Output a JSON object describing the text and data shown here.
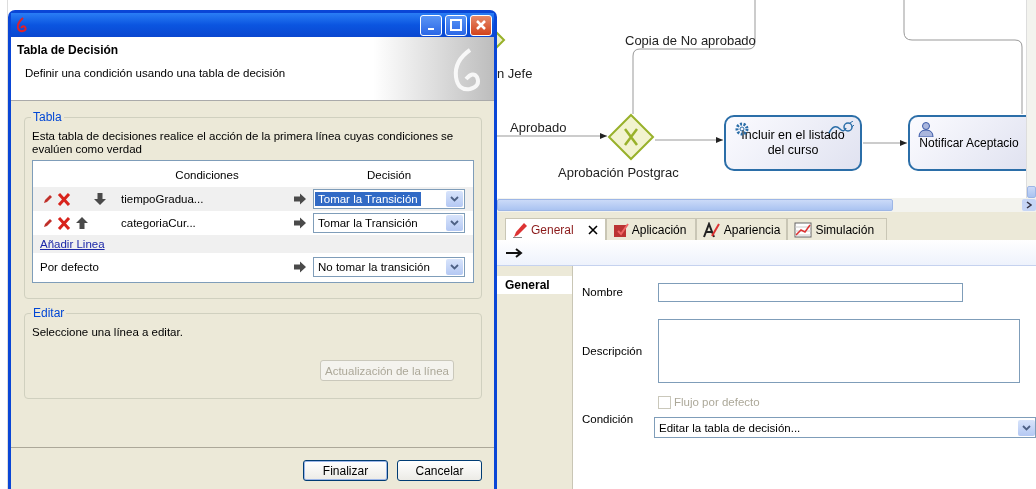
{
  "dialog": {
    "title": "Tabla de Decisión",
    "subtitle": "Definir una condición usando una tabla de decisión",
    "table_group": {
      "label": "Tabla",
      "description": "Esta tabla de decisiones realice el acción de la primera línea cuyas condiciones se evalúen como verdad",
      "columns": [
        "Condiciones",
        "Decisión"
      ],
      "rows": [
        {
          "condition": "tiempoGradua...",
          "decision": "Tomar la Transición",
          "kind": "down-arrow",
          "selected": true
        },
        {
          "condition": "categoriaCur...",
          "decision": "Tomar la Transición",
          "kind": "up-arrow",
          "selected": false
        }
      ],
      "add_link": "Añadir Linea",
      "default_row": {
        "label": "Por defecto",
        "decision": "No tomar la transición"
      }
    },
    "edit_group": {
      "label": "Editar",
      "hint": "Seleccione una línea a editar.",
      "update_button": {
        "label": "Actualización de la línea",
        "disabled": true
      }
    },
    "buttons": [
      "Finalizar",
      "Cancelar"
    ]
  },
  "diagram": {
    "flows": [
      {
        "label": "Copia de No aprobado"
      },
      {
        "label": "Aprobado"
      }
    ],
    "nodes": [
      {
        "kind": "gateway",
        "label": "n Jefe"
      },
      {
        "kind": "gateway",
        "label": "Aprobación Postgrac"
      },
      {
        "kind": "service-task",
        "label": "Incluir en el listado del curso"
      },
      {
        "kind": "user-task",
        "label": "Notificar Aceptacio"
      }
    ]
  },
  "properties": {
    "tabs": [
      {
        "kind": "general",
        "label": "General",
        "selected": true
      },
      {
        "kind": "application",
        "label": "Aplicación",
        "selected": false
      },
      {
        "kind": "appearance",
        "label": "Apariencia",
        "selected": false
      },
      {
        "kind": "simulation",
        "label": "Simulación",
        "selected": false
      }
    ],
    "sections": [
      {
        "label": "General",
        "selected": true
      }
    ],
    "form": {
      "name_label": "Nombre",
      "description_label": "Descripción",
      "condition_label": "Condición",
      "default_flow": {
        "label": "Flujo por defecto",
        "checked": false,
        "disabled": true
      },
      "condition_select": "Editar la tabla de decisión..."
    }
  }
}
